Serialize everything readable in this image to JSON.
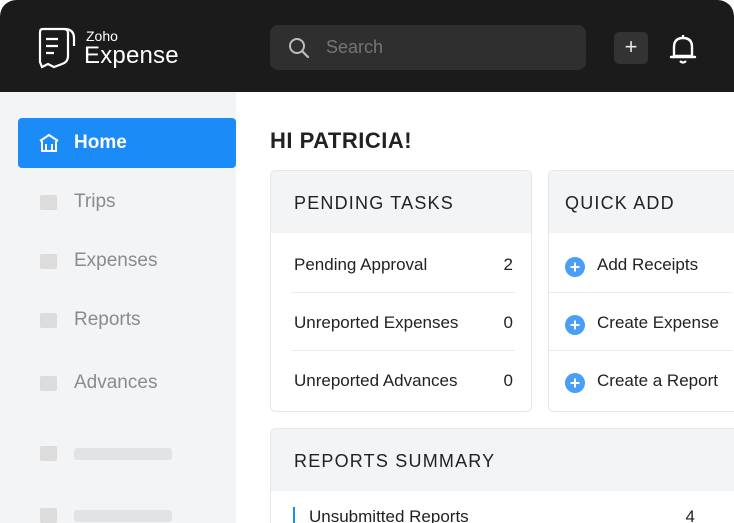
{
  "brand": {
    "small": "Zoho",
    "name": "Expense"
  },
  "search": {
    "placeholder": "Search"
  },
  "topbar": {
    "add_label": "+",
    "bell_icon": "bell-icon"
  },
  "sidebar": {
    "items": [
      {
        "label": "Home",
        "active": true,
        "icon": "home-icon"
      },
      {
        "label": "Trips"
      },
      {
        "label": "Expenses"
      },
      {
        "label": "Reports"
      },
      {
        "label": "Advances"
      },
      {
        "label": ""
      },
      {
        "label": ""
      }
    ]
  },
  "main": {
    "greeting": "HI PATRICIA!",
    "pending": {
      "title": "PENDING TASKS",
      "rows": [
        {
          "label": "Pending Approval",
          "value": "2"
        },
        {
          "label": "Unreported Expenses",
          "value": "0"
        },
        {
          "label": "Unreported Advances",
          "value": "0"
        }
      ]
    },
    "quick_add": {
      "title": "QUICK ADD",
      "items": [
        {
          "label": "Add Receipts"
        },
        {
          "label": "Create Expense"
        },
        {
          "label": "Create a Report"
        }
      ]
    },
    "summary": {
      "title": "REPORTS SUMMARY",
      "rows": [
        {
          "label": "Unsubmitted Reports",
          "value": "4"
        }
      ]
    }
  },
  "colors": {
    "accent": "#1b8cf7",
    "topbar": "#1b1b1b",
    "sidebar": "#f3f4f6"
  }
}
